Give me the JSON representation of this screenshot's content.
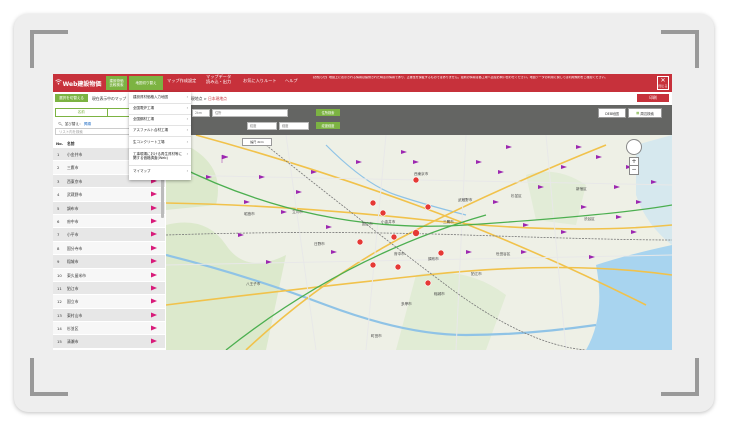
{
  "topbar": {
    "logo_text": "Web建設物価",
    "logo_icon": "wifi-icon",
    "button1_line1": "建設物価",
    "button1_line2": "比較検索",
    "button2_label": "地図切り替え",
    "menu": [
      "マップ作成設定",
      "マップデータ\n読み込・出力",
      "お気に入りルート",
      "ヘルプ"
    ],
    "notice": "【お知らせ】地図上に表示される情報は提供された時点の情報であり、正確性を保証するものではありません。最新の情報は各工場へ直接お問い合わせください。地図データの利用に関しては利用規約をご確認ください。",
    "close_label": "閉じる",
    "close_icon": "close-icon",
    "accent_color": "#c7313b"
  },
  "bar2": {
    "select_button": "選択を切替える",
    "area_text": "現在表示中のマップ",
    "crumb_prev": "ジ）",
    "crumb_label": "現地点",
    "crumb_value": "日本現地点",
    "print_button": "印刷"
  },
  "dropdown": {
    "items": [
      "建設資材価格入力地図",
      "全国電炉工場",
      "全国鋼材工場",
      "アスファルト合材工場",
      "生コンクリート工場",
      "工事現場における再生資材等に関する価格調査(Web)",
      "マイマップ"
    ]
  },
  "left_panel": {
    "tabs": [
      "名前",
      "距離"
    ],
    "sort_label": "並び替え：",
    "sort_link": "昇順",
    "search_placeholder": "リスト内を検索",
    "col_no": "No.",
    "col_name": "名前",
    "rows": [
      {
        "no": "1",
        "name": "小金井市"
      },
      {
        "no": "2",
        "name": "三鷹市"
      },
      {
        "no": "3",
        "name": "西東京市"
      },
      {
        "no": "4",
        "name": "武蔵野市"
      },
      {
        "no": "5",
        "name": "調布市"
      },
      {
        "no": "6",
        "name": "府中市"
      },
      {
        "no": "7",
        "name": "小平市"
      },
      {
        "no": "8",
        "name": "国分寺市"
      },
      {
        "no": "9",
        "name": "稲城市"
      },
      {
        "no": "10",
        "name": "東久留米市"
      },
      {
        "no": "11",
        "name": "狛江市"
      },
      {
        "no": "12",
        "name": "国立市"
      },
      {
        "no": "13",
        "name": "東村山市"
      },
      {
        "no": "14",
        "name": "杉並区"
      },
      {
        "no": "15",
        "name": "清瀬市"
      }
    ],
    "flag_color": "#d81b7a"
  },
  "map": {
    "input1": "2km",
    "input2": "住所",
    "search_button": "住所検索",
    "field3": "緯度",
    "field4": "経度",
    "latlng_button": "緯度経度",
    "mode_label": "DEB地図",
    "print_map_label": "周辺検索",
    "scale_label": "縮尺 2km",
    "labels": [
      "国立市",
      "府中市",
      "調布市",
      "小金井市",
      "三鷹市",
      "武蔵野市",
      "西東京市",
      "杉並区",
      "世田谷区",
      "多摩市",
      "稲城市",
      "町田市",
      "八王子市",
      "日野市",
      "立川市",
      "昭島市",
      "狛江市",
      "新宿区",
      "渋谷区"
    ],
    "pin_color": "#e53935",
    "flag_color": "#9c27b0"
  }
}
